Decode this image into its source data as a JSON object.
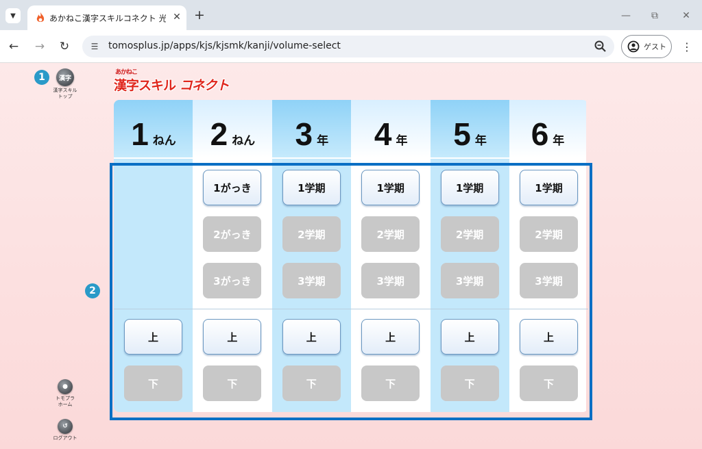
{
  "browser": {
    "tab_title": "あかねこ漢字スキルコネクト 光村図書",
    "url": "tomosplus.jp/apps/kjs/kjsmk/kanji/volume-select",
    "guest_label": "ゲスト"
  },
  "sidebar": {
    "top_icon_text": "漢字",
    "top_label": "漢字スキル\nトップ",
    "home_label": "トモプラ\nホーム",
    "logout_label": "ログアウト"
  },
  "badges": {
    "one": "1",
    "two": "2"
  },
  "logo": {
    "small": "あかねこ",
    "main": "漢字スキル",
    "connect": "コネクト"
  },
  "grades": [
    {
      "num": "1",
      "unit": "ねん",
      "tint": "#c3e8fb",
      "terms": [],
      "vols": [
        {
          "label": "上",
          "enabled": true
        },
        {
          "label": "下",
          "enabled": false
        }
      ]
    },
    {
      "num": "2",
      "unit": "ねん",
      "tint": "#ffffff",
      "terms": [
        {
          "label": "1がっき",
          "enabled": true
        },
        {
          "label": "2がっき",
          "enabled": false
        },
        {
          "label": "3がっき",
          "enabled": false
        }
      ],
      "vols": [
        {
          "label": "上",
          "enabled": true
        },
        {
          "label": "下",
          "enabled": false
        }
      ]
    },
    {
      "num": "3",
      "unit": "年",
      "tint": "#c3e8fb",
      "terms": [
        {
          "label": "1学期",
          "enabled": true
        },
        {
          "label": "2学期",
          "enabled": false
        },
        {
          "label": "3学期",
          "enabled": false
        }
      ],
      "vols": [
        {
          "label": "上",
          "enabled": true
        },
        {
          "label": "下",
          "enabled": false
        }
      ]
    },
    {
      "num": "4",
      "unit": "年",
      "tint": "#ffffff",
      "terms": [
        {
          "label": "1学期",
          "enabled": true
        },
        {
          "label": "2学期",
          "enabled": false
        },
        {
          "label": "3学期",
          "enabled": false
        }
      ],
      "vols": [
        {
          "label": "上",
          "enabled": true
        },
        {
          "label": "下",
          "enabled": false
        }
      ]
    },
    {
      "num": "5",
      "unit": "年",
      "tint": "#c3e8fb",
      "terms": [
        {
          "label": "1学期",
          "enabled": true
        },
        {
          "label": "2学期",
          "enabled": false
        },
        {
          "label": "3学期",
          "enabled": false
        }
      ],
      "vols": [
        {
          "label": "上",
          "enabled": true
        },
        {
          "label": "下",
          "enabled": false
        }
      ]
    },
    {
      "num": "6",
      "unit": "年",
      "tint": "#ffffff",
      "terms": [
        {
          "label": "1学期",
          "enabled": true
        },
        {
          "label": "2学期",
          "enabled": false
        },
        {
          "label": "3学期",
          "enabled": false
        }
      ],
      "vols": [
        {
          "label": "上",
          "enabled": true
        },
        {
          "label": "下",
          "enabled": false
        }
      ]
    }
  ],
  "colors": {
    "highlight": "#0a6fc4",
    "badge": "#2a9ac8",
    "button_disabled": "#c8c8c8",
    "brand_red": "#e0261c"
  }
}
